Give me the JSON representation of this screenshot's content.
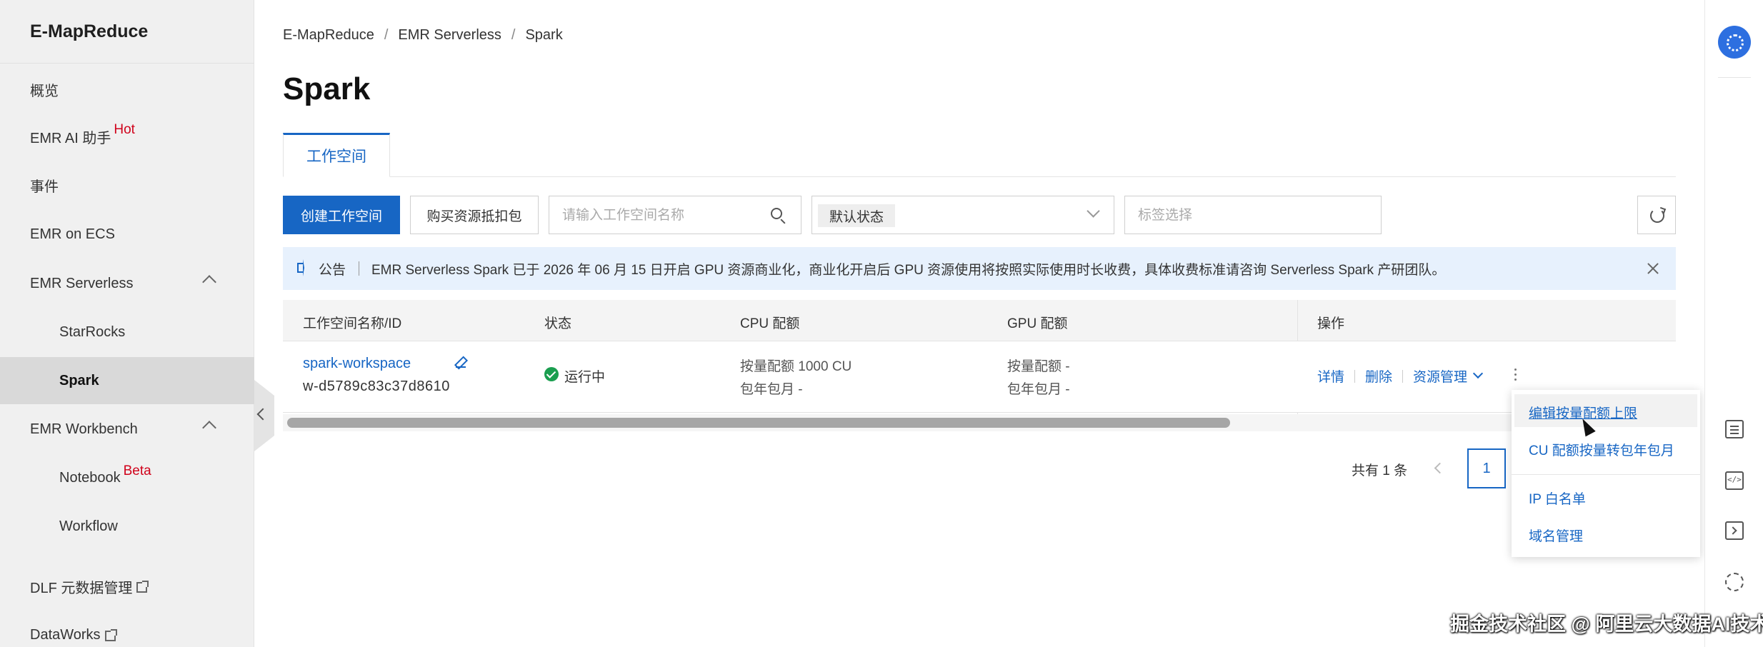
{
  "sidebar": {
    "brand": "E-MapReduce",
    "items": [
      {
        "label": "概览"
      },
      {
        "label": "EMR AI 助手",
        "badge": "Hot"
      },
      {
        "label": "事件"
      },
      {
        "label": "EMR on ECS"
      },
      {
        "label": "EMR Serverless"
      },
      {
        "label": "StarRocks"
      },
      {
        "label": "Spark"
      },
      {
        "label": "EMR Workbench"
      },
      {
        "label": "Notebook",
        "badge": "Beta"
      },
      {
        "label": "Workflow"
      },
      {
        "label": "DLF 元数据管理"
      },
      {
        "label": "DataWorks"
      }
    ]
  },
  "breadcrumb": [
    "E-MapReduce",
    "EMR Serverless",
    "Spark"
  ],
  "page_title": "Spark",
  "tabs": [
    {
      "label": "工作空间"
    }
  ],
  "toolbar": {
    "create_label": "创建工作空间",
    "buy_label": "购买资源抵扣包",
    "search_placeholder": "请输入工作空间名称",
    "status_select": "默认状态",
    "tag_placeholder": "标签选择"
  },
  "notice": {
    "label": "公告",
    "text": "EMR Serverless Spark 已于 2026 年 06 月 15 日开启 GPU 资源商业化，商业化开启后 GPU 资源使用将按照实际使用时长收费，具体收费标准请咨询 Serverless Spark 产研团队。"
  },
  "table": {
    "columns": [
      "工作空间名称/ID",
      "状态",
      "CPU 配额",
      "GPU 配额",
      "操作"
    ],
    "rows": [
      {
        "name": "spark-workspace",
        "id": "w-d5789c83c37d8610",
        "status": "运行中",
        "cpu_line1": "按量配额 1000 CU",
        "cpu_line2": "包年包月 -",
        "gpu_line1": "按量配额 -",
        "gpu_line2": "包年包月 -",
        "ops": [
          "详情",
          "删除",
          "资源管理"
        ]
      }
    ]
  },
  "pagination": {
    "total": "共有 1 条",
    "current": "1"
  },
  "dropdown": {
    "items": [
      "编辑按量配额上限",
      "CU 配额按量转包年包月",
      "IP 白名单",
      "域名管理"
    ]
  },
  "watermark": "掘金技术社区 @ 阿里云大数据AI技术",
  "colors": {
    "primary": "#1766c4",
    "success": "#1a9e4f",
    "hot": "#d0021b",
    "notice_bg": "#e7f1fd"
  }
}
